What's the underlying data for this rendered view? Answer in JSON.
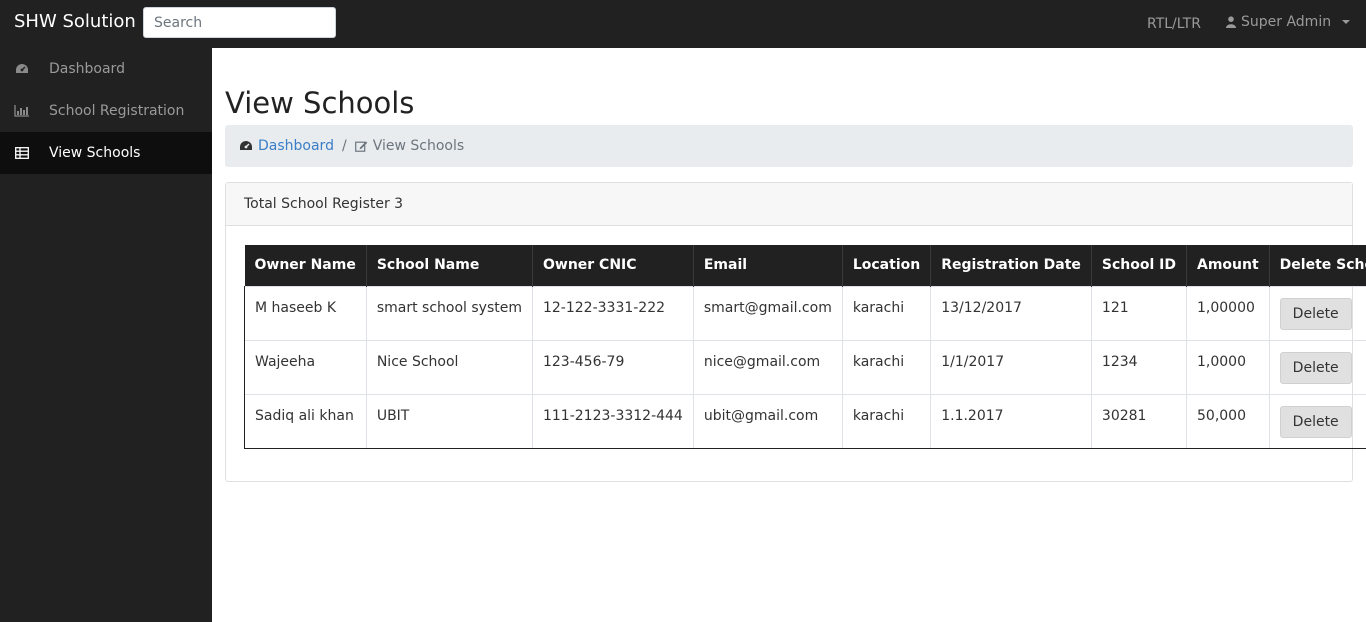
{
  "navbar": {
    "brand": "SHW Solution",
    "search_placeholder": "Search",
    "rtl_label": "RTL/LTR",
    "user_label": "Super Admin"
  },
  "sidebar": {
    "items": [
      {
        "label": "Dashboard",
        "icon": "dashboard-icon"
      },
      {
        "label": "School Registration",
        "icon": "bar-chart-icon"
      },
      {
        "label": "View Schools",
        "icon": "table-icon",
        "active": true
      }
    ]
  },
  "page": {
    "title": "View Schools",
    "breadcrumb": {
      "home": "Dashboard",
      "separator": "/",
      "current": "View Schools"
    },
    "card_header": "Total School Register 3"
  },
  "table": {
    "headers": [
      "Owner Name",
      "School Name",
      "Owner CNIC",
      "Email",
      "Location",
      "Registration Date",
      "School ID",
      "Amount",
      "Delete School"
    ],
    "rows": [
      {
        "owner": "M haseeb K",
        "school": "smart school system",
        "cnic": "12-122-3331-222",
        "email": "smart@gmail.com",
        "location": "karachi",
        "date": "13/12/2017",
        "id": "121",
        "amount": "1,00000",
        "action": "Delete"
      },
      {
        "owner": "Wajeeha",
        "school": "Nice School",
        "cnic": "123-456-79",
        "email": "nice@gmail.com",
        "location": "karachi",
        "date": "1/1/2017",
        "id": "1234",
        "amount": "1,0000",
        "action": "Delete"
      },
      {
        "owner": "Sadiq ali khan",
        "school": "UBIT",
        "cnic": "111-2123-3312-444",
        "email": "ubit@gmail.com",
        "location": "karachi",
        "date": "1.1.2017",
        "id": "30281",
        "amount": "50,000",
        "action": "Delete"
      }
    ]
  },
  "colors": {
    "navbar_bg": "#212121",
    "sidebar_active_bg": "#0e0e0e",
    "link": "#3a7ec7",
    "breadcrumb_bg": "#e9ecef"
  }
}
